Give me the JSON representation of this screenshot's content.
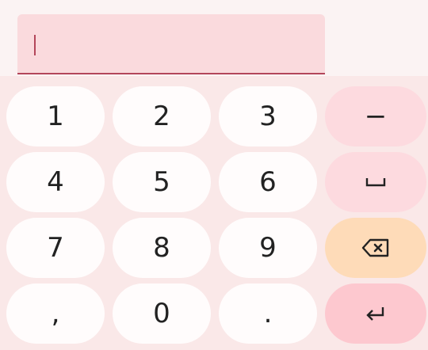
{
  "input": {
    "value": "",
    "accent_color": "#b3465a"
  },
  "keys": {
    "row1": [
      "1",
      "2",
      "3"
    ],
    "row2": [
      "4",
      "5",
      "6"
    ],
    "row3": [
      "7",
      "8",
      "9"
    ],
    "row4": [
      ",",
      "0",
      "."
    ]
  },
  "function_keys": {
    "minus": "−",
    "space_icon": "space-bar-icon",
    "backspace_icon": "backspace-icon",
    "enter_icon": "enter-return-icon"
  },
  "colors": {
    "number_key": "#fffcfc",
    "function_key": "#fddadf",
    "backspace_key": "#fedbb8",
    "enter_key": "#fdc8cf"
  }
}
